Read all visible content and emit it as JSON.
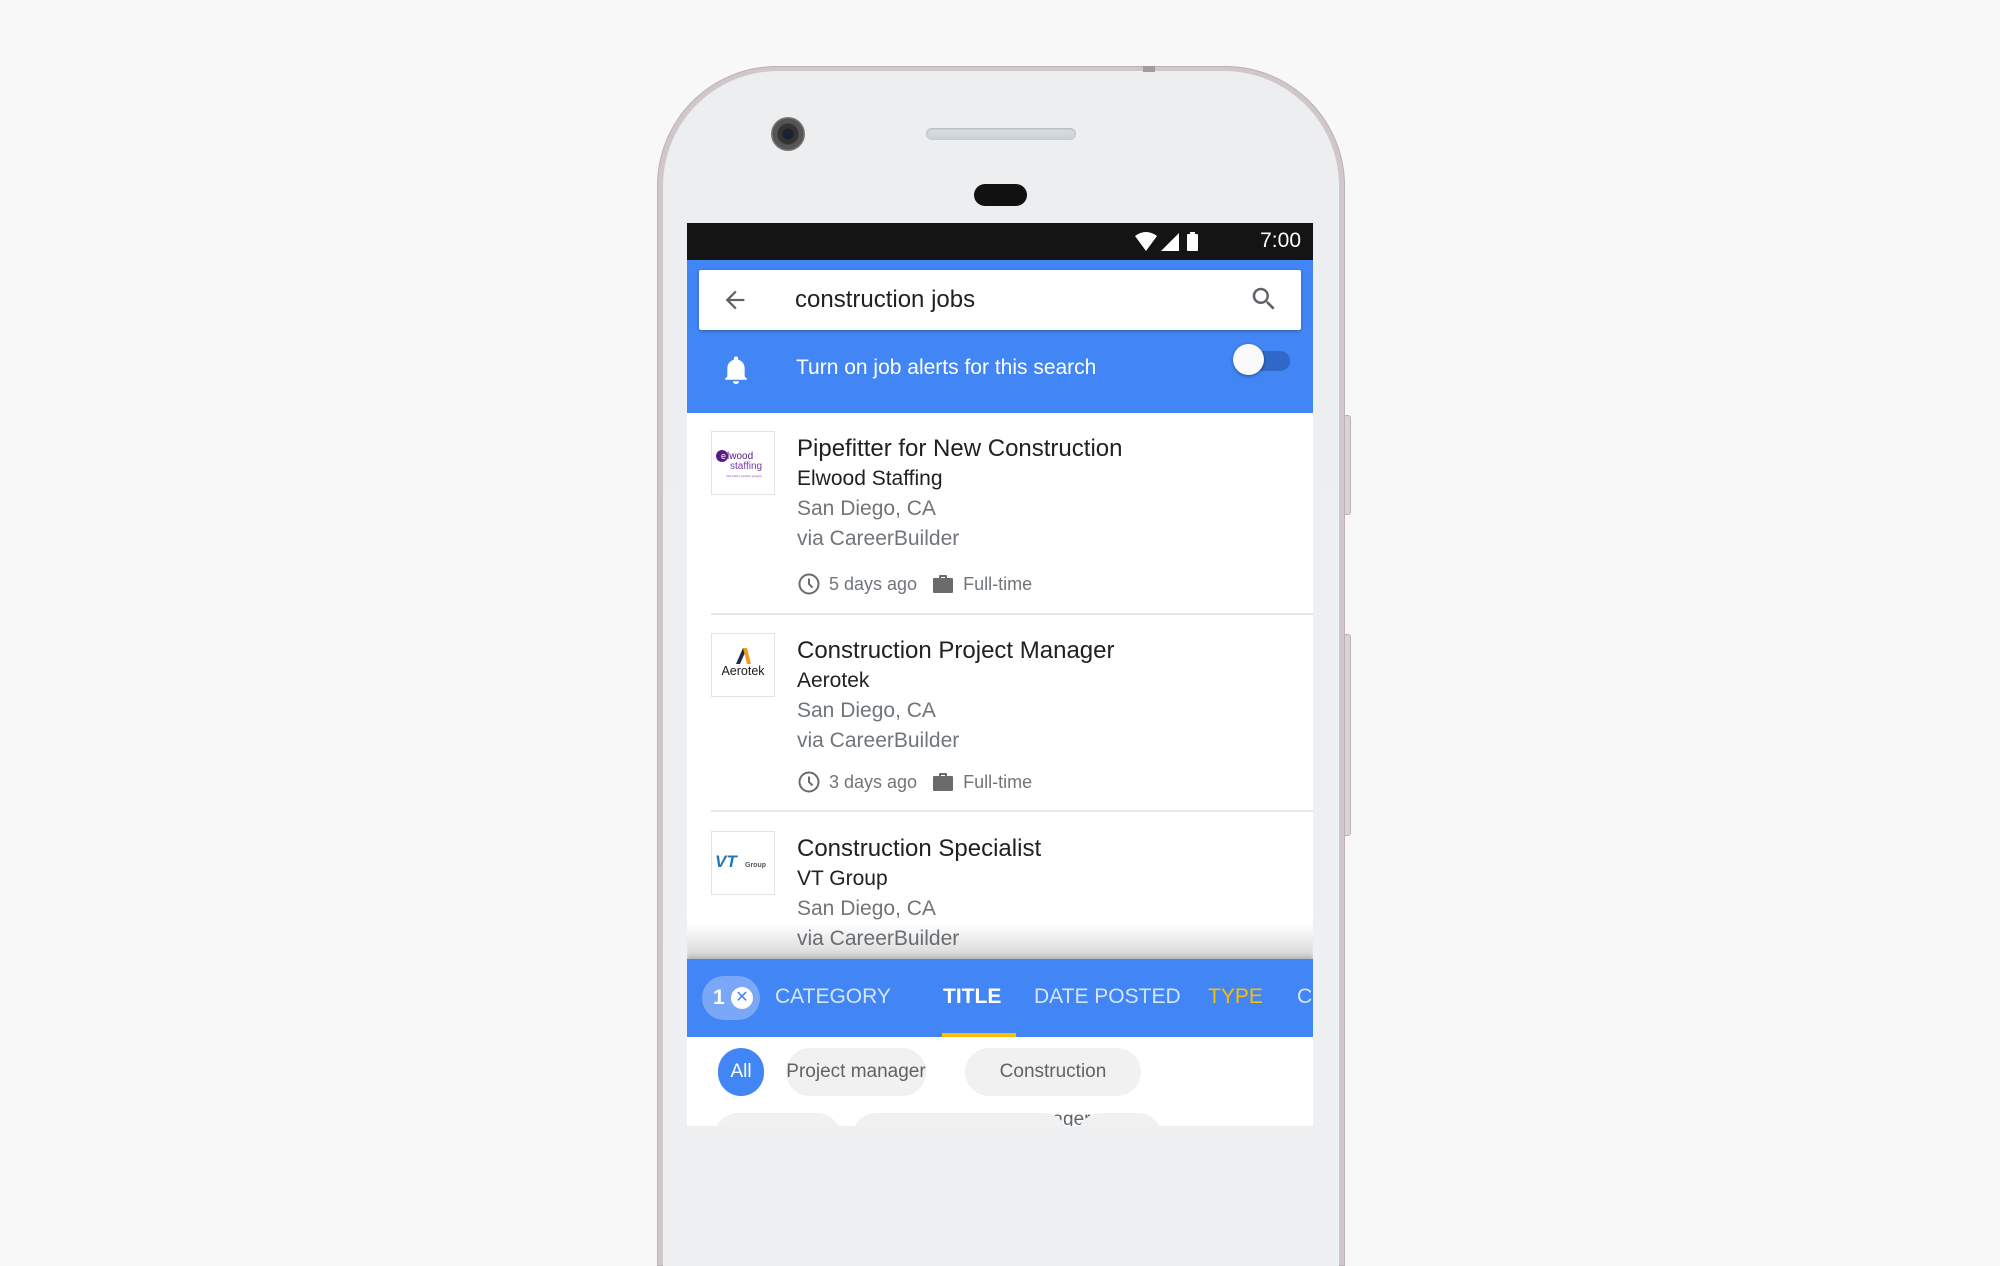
{
  "status_bar": {
    "time": "7:00",
    "icons": [
      "wifi-icon",
      "signal-icon",
      "battery-icon"
    ]
  },
  "search": {
    "query": "construction jobs",
    "back_icon": "arrow-back-icon",
    "search_icon": "search-icon"
  },
  "alerts": {
    "label": "Turn on job alerts for this search",
    "icon": "bell-icon",
    "toggle_on": false
  },
  "jobs": [
    {
      "title": "Pipefitter for New Construction",
      "company": "Elwood Staffing",
      "location": "San Diego, CA",
      "source": "via CareerBuilder",
      "posted": "5 days ago",
      "type": "Full-time",
      "logo_text": "elwood staffing",
      "logo_tagline": "The better people, people."
    },
    {
      "title": "Construction Project Manager",
      "company": "Aerotek",
      "location": "San Diego, CA",
      "source": "via CareerBuilder",
      "posted": "3 days ago",
      "type": "Full-time",
      "logo_text": "Aerotek"
    },
    {
      "title": "Construction Specialist",
      "company": "VT Group",
      "location": "San Diego, CA",
      "source": "via CareerBuilder",
      "logo_text": "VT",
      "logo_sub": "Group"
    }
  ],
  "filters": {
    "active_count": "1",
    "clear_icon": "close-icon",
    "tabs": [
      {
        "label": "CATEGORY"
      },
      {
        "label": "TITLE",
        "active": true
      },
      {
        "label": "DATE POSTED"
      },
      {
        "label": "TYPE",
        "highlighted": true
      },
      {
        "label": "CO"
      }
    ],
    "chips": [
      {
        "label": "All",
        "selected": true
      },
      {
        "label": "Project manager"
      },
      {
        "label": "Construction manager"
      }
    ]
  },
  "colors": {
    "brand_blue": "#4285f4",
    "accent_yellow": "#fbbc04",
    "toggle_track": "#2f68c7"
  }
}
